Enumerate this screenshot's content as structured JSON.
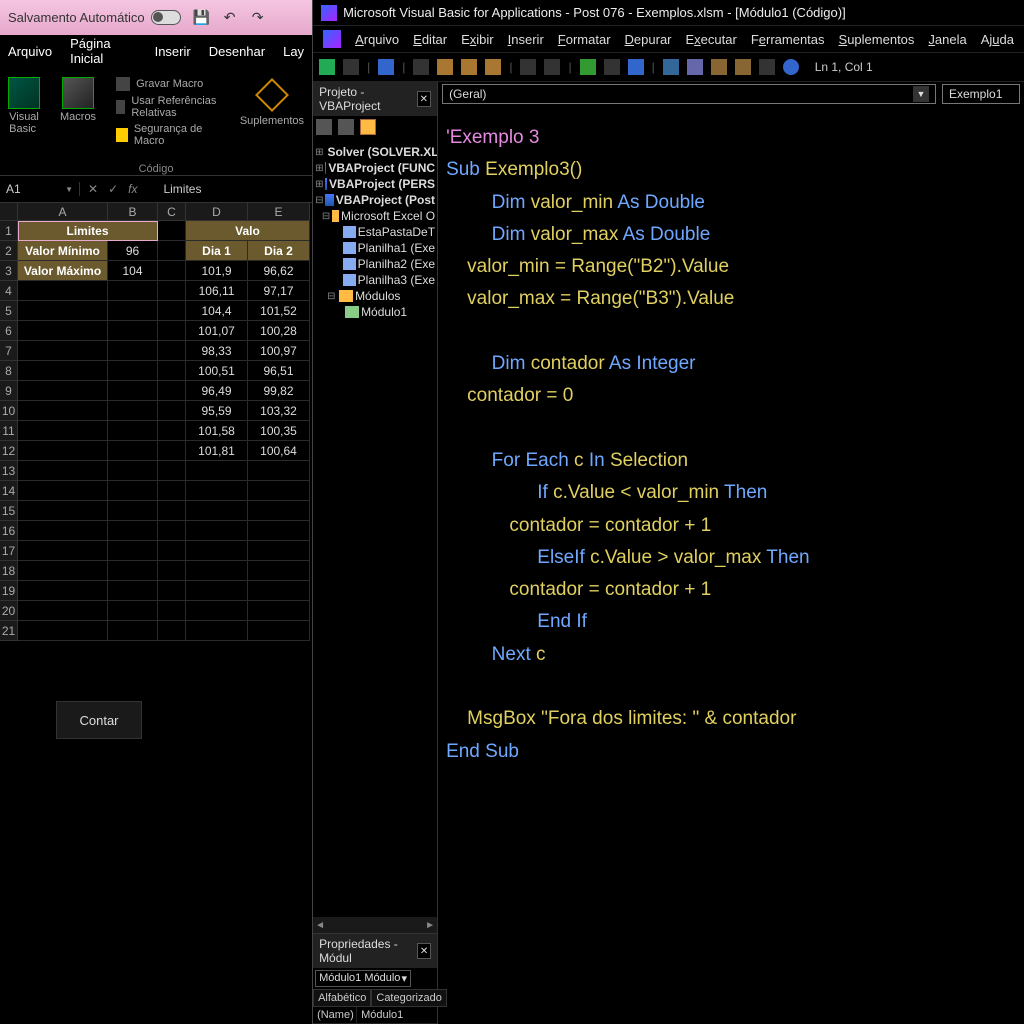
{
  "excel": {
    "titlebar_label": "Salvamento Automático",
    "menu": [
      "Arquivo",
      "Página Inicial",
      "Inserir",
      "Desenhar",
      "Lay"
    ],
    "ribbon": {
      "visual_basic": "Visual\nBasic",
      "macros": "Macros",
      "gravar_macro": "Gravar Macro",
      "usar_ref": "Usar Referências Relativas",
      "seg_macro": "Segurança de Macro",
      "suplementos": "Suplementos",
      "group_label": "Código"
    },
    "namebox": "A1",
    "fx_value": "Limites",
    "columns": [
      "A",
      "B",
      "C",
      "D",
      "E"
    ],
    "header_limites": "Limites",
    "header_valores": "Valo",
    "labels": {
      "min": "Valor Mínimo",
      "max": "Valor Máximo",
      "dia1": "Dia 1",
      "dia2": "Dia 2"
    },
    "min_val": "96",
    "max_val": "104",
    "data_rows": [
      [
        "101,9",
        "96,62"
      ],
      [
        "106,11",
        "97,17"
      ],
      [
        "104,4",
        "101,52"
      ],
      [
        "101,07",
        "100,28"
      ],
      [
        "98,33",
        "100,97"
      ],
      [
        "100,51",
        "96,51"
      ],
      [
        "96,49",
        "99,82"
      ],
      [
        "95,59",
        "103,32"
      ],
      [
        "101,58",
        "100,35"
      ],
      [
        "101,81",
        "100,64"
      ]
    ],
    "button_contar": "Contar"
  },
  "vbe": {
    "title": "Microsoft Visual Basic for Applications - Post 076 - Exemplos.xlsm - [Módulo1 (Código)]",
    "menu": [
      "Arquivo",
      "Editar",
      "Exibir",
      "Inserir",
      "Formatar",
      "Depurar",
      "Executar",
      "Ferramentas",
      "Suplementos",
      "Janela",
      "Ajuda"
    ],
    "lncol": "Ln 1, Col 1",
    "project_pane_title": "Projeto - VBAProject",
    "tree": {
      "solver": "Solver (SOLVER.XL",
      "func": "VBAProject (FUNC",
      "pers": "VBAProject (PERS",
      "post": "VBAProject (Post",
      "excel_obj": "Microsoft Excel O",
      "sheets": [
        "EstaPastaDeT",
        "Planilha1 (Exe",
        "Planilha2 (Exe",
        "Planilha3 (Exe"
      ],
      "modules_folder": "Módulos",
      "module1": "Módulo1"
    },
    "properties_pane_title": "Propriedades - Módul",
    "prop_combo": "Módulo1 Módulo",
    "prop_tabs": [
      "Alfabético",
      "Categorizado"
    ],
    "prop_name_label": "(Name)",
    "prop_name_value": "Módulo1",
    "combo_general": "(Geral)",
    "combo_proc": "Exemplo1",
    "code": {
      "l1": "'Exemplo 3",
      "l2_sub": "Sub",
      "l2_name": " Exemplo3()",
      "l3_dim": "Dim",
      "l3_var": " valor_min ",
      "l3_as": "As Double",
      "l4_dim": "Dim",
      "l4_var": " valor_max ",
      "l4_as": "As Double",
      "l5": "    valor_min = Range(",
      "l5_str": "\"B2\"",
      "l5_b": ").Value",
      "l6": "    valor_max = Range(",
      "l6_str": "\"B3\"",
      "l6_b": ").Value",
      "l7_dim": "Dim",
      "l7_var": " contador ",
      "l7_as": "As Integer",
      "l8": "    contador = 0",
      "l9_for": "For Each",
      "l9_mid": " c ",
      "l9_in": "In",
      "l9_tail": " Selection",
      "l10_if": "If",
      "l10_mid": " c.Value < valor_min ",
      "l10_then": "Then",
      "l11": "            contador = contador + 1",
      "l12_elif": "ElseIf",
      "l12_mid": " c.Value > valor_max ",
      "l12_then": "Then",
      "l13": "            contador = contador + 1",
      "l14": "End If",
      "l15_next": "Next",
      "l15_c": " c",
      "l16_msg": "    MsgBox ",
      "l16_str": "\"Fora dos limites: \"",
      "l16_tail": " & contador",
      "l17": "End Sub"
    }
  }
}
